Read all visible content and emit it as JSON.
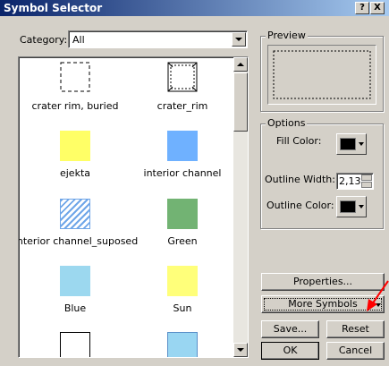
{
  "window": {
    "title": "Symbol Selector",
    "help_label": "?",
    "close_label": "X"
  },
  "category": {
    "label": "Category:",
    "value": "All"
  },
  "symbols": [
    {
      "name": "crater rim, buried",
      "style": "dashed-rect"
    },
    {
      "name": "crater_rim",
      "style": "hatched-rect"
    },
    {
      "name": "ejekta",
      "fill": "#ffff66"
    },
    {
      "name": "interior channel",
      "fill": "#6fb1ff"
    },
    {
      "name": "interior channel_suposed",
      "fill": "hatch-blue"
    },
    {
      "name": "Green",
      "fill": "#72b373"
    },
    {
      "name": "Blue",
      "fill": "#9cd8ef"
    },
    {
      "name": "Sun",
      "fill": "#ffff7a"
    },
    {
      "name": "",
      "fill": "#ffffff"
    },
    {
      "name": "",
      "fill": "#99d6f2"
    }
  ],
  "preview": {
    "label": "Preview"
  },
  "options": {
    "label": "Options",
    "fill_color_label": "Fill Color:",
    "fill_color": "#000000",
    "outline_width_label": "Outline Width:",
    "outline_width_value": "2,13",
    "outline_color_label": "Outline Color:",
    "outline_color": "#000000"
  },
  "buttons": {
    "properties": "Properties...",
    "more_symbols": "More Symbols",
    "save": "Save...",
    "reset": "Reset",
    "ok": "OK",
    "cancel": "Cancel"
  },
  "colors": {
    "title_start": "#0a246a",
    "title_end": "#a6caf0",
    "dialog_bg": "#d4d0c8",
    "annotation_arrow": "#ff0000"
  }
}
